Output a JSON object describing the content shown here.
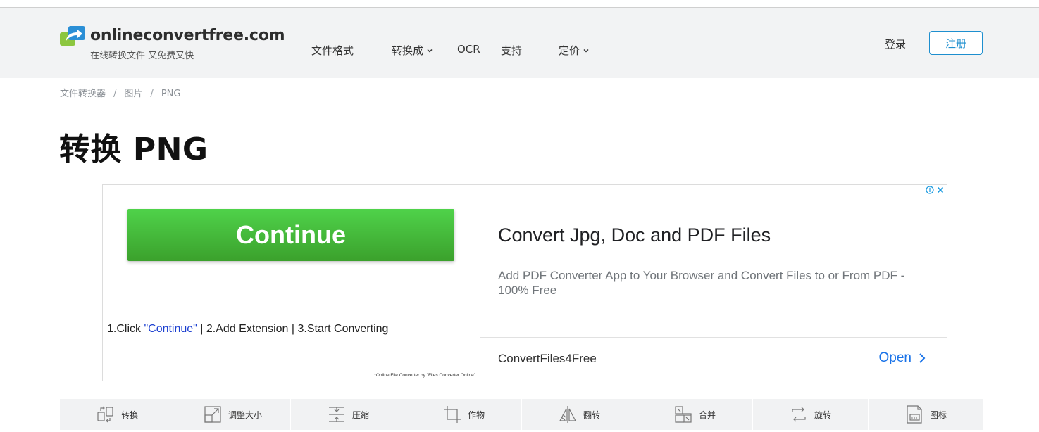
{
  "header": {
    "logo_name": "onlineconvertfree.com",
    "logo_tagline": "在线转换文件 又免费又快",
    "nav": [
      {
        "label": "文件格式",
        "dropdown": false
      },
      {
        "label": "转换成",
        "dropdown": true
      },
      {
        "label": "OCR",
        "dropdown": false
      },
      {
        "label": "支持",
        "dropdown": false
      },
      {
        "label": "定价",
        "dropdown": true
      }
    ],
    "login_label": "登录",
    "signup_label": "注册"
  },
  "breadcrumb": [
    "文件转换器",
    "图片",
    "PNG"
  ],
  "breadcrumb_separator": "/",
  "page_title": "转换 PNG",
  "ad": {
    "continue_label": "Continue",
    "steps_prefix": "1.Click ",
    "steps_highlight": "\"Continue\"",
    "steps_suffix": " | 2.Add Extension | 3.Start Converting",
    "credit": "*Online File Converter by \"Files Converter Online\"",
    "headline": "Convert Jpg, Doc and PDF Files",
    "description": "Add PDF Converter App to Your Browser and Convert Files to or From PDF - 100% Free",
    "brand": "ConvertFiles4Free",
    "open_label": "Open"
  },
  "toolbar": [
    {
      "label": "转换",
      "icon": "convert-icon"
    },
    {
      "label": "调整大小",
      "icon": "resize-icon"
    },
    {
      "label": "压缩",
      "icon": "compress-icon"
    },
    {
      "label": "作物",
      "icon": "crop-icon"
    },
    {
      "label": "翻转",
      "icon": "flip-icon"
    },
    {
      "label": "合并",
      "icon": "merge-icon"
    },
    {
      "label": "旋转",
      "icon": "rotate-icon"
    },
    {
      "label": "图标",
      "icon": "ico-icon"
    }
  ],
  "colors": {
    "header_bg": "#f2f3f4",
    "signup_accent": "#1e8fcf",
    "continue_green": "#45b83a",
    "ad_link_blue": "#1a73e8",
    "logo_blue": "#2b8fd6",
    "logo_green": "#8cc63f"
  }
}
